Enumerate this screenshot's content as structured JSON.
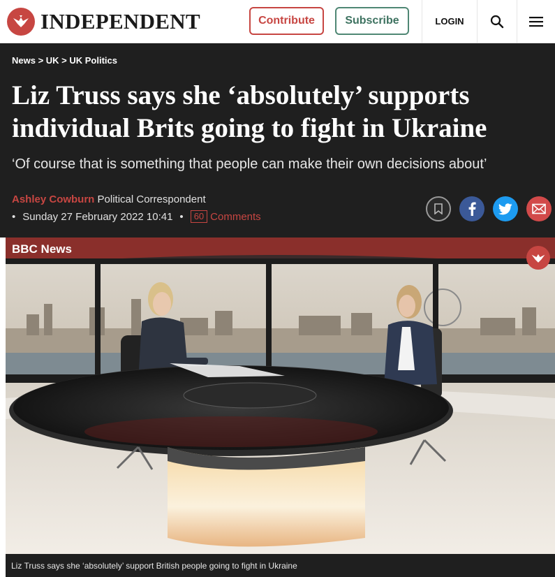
{
  "header": {
    "logo_text": "INDEPENDENT",
    "contribute_label": "Contribute",
    "subscribe_label": "Subscribe",
    "login_label": "LOGIN",
    "icons": [
      "eagle-logo-icon",
      "search-icon",
      "hamburger-menu-icon"
    ]
  },
  "article": {
    "breadcrumb": "News > UK > UK Politics",
    "headline": "Liz Truss says she ‘absolutely’ supports individual Brits going to fight in Ukraine",
    "standfirst": "‘Of course that is something that people can make their own decisions about’",
    "author": "Ashley Cowburn",
    "author_role": "Political Correspondent",
    "bullet": "•",
    "date": "Sunday 27 February 2022 10:41",
    "comment_count": "60",
    "comments_label": "Comments"
  },
  "share": {
    "icons": [
      "bookmark-icon",
      "facebook-icon",
      "twitter-icon",
      "email-icon"
    ]
  },
  "video": {
    "source_label": "BBC News",
    "caption": "Liz Truss says she ‘absolutely’ support British people going to fight in Ukraine"
  },
  "colors": {
    "brand_red": "#c74642",
    "subscribe_green": "#3d7260",
    "dark_bg": "#1f1f1f",
    "facebook": "#3b5998",
    "twitter": "#1d9bf0"
  }
}
